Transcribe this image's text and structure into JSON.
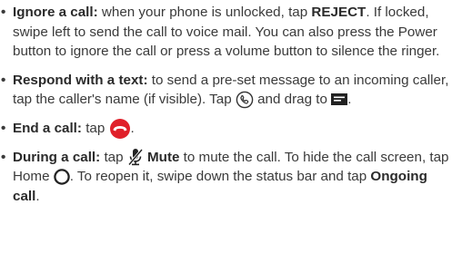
{
  "items": [
    {
      "label": "Ignore a call:",
      "t1": " when your phone is unlocked, tap ",
      "kw": "REJECT",
      "t2": ". If locked, swipe left to send the call to voice mail. You can also press the Power button to ignore the call or press a volume button to silence the ringer."
    },
    {
      "label": "Respond with a text:",
      "t1": " to send a pre-set message to an incoming caller, tap the caller's name (if visible). Tap ",
      "icon1": "phone-answer-icon",
      "t2": " and drag to ",
      "icon2": "message-icon",
      "t3": "."
    },
    {
      "label": "End a call:",
      "t1": " tap ",
      "icon": "end-call-icon",
      "t2": "."
    },
    {
      "label": "During a call:",
      "t1": " tap ",
      "icon1": "microphone-mute-icon",
      "kw": "Mute",
      "t2": " to mute the call. To hide the call screen, tap Home ",
      "icon2": "home-icon",
      "t3": ". To reopen it, swipe down the status bar and tap ",
      "kw2": "Ongoing call",
      "t4": "."
    }
  ],
  "colors": {
    "end_call": "#e0202a",
    "text": "#3a3a3a"
  }
}
